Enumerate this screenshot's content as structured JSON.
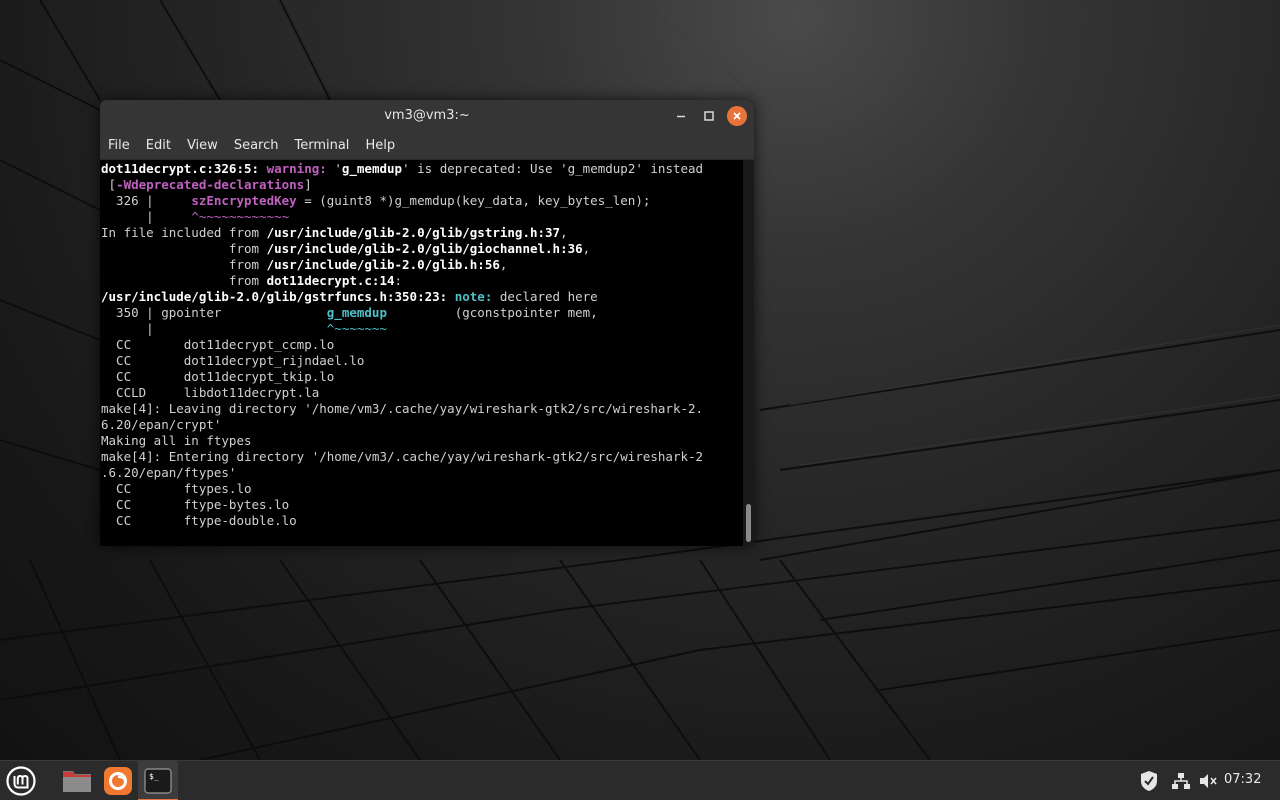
{
  "window": {
    "title": "vm3@vm3:~",
    "minimize_icon": "minimize-icon",
    "maximize_icon": "maximize-icon",
    "close_icon": "close-icon"
  },
  "menubar": {
    "items": [
      "File",
      "Edit",
      "View",
      "Search",
      "Terminal",
      "Help"
    ]
  },
  "terminal": {
    "lines": [
      [
        {
          "t": "dot11decrypt.c:326:5: ",
          "c": "b"
        },
        {
          "t": "warning: ",
          "c": "warn"
        },
        {
          "t": "'",
          "c": ""
        },
        {
          "t": "g_memdup",
          "c": "b"
        },
        {
          "t": "' is deprecated: Use 'g_memdup2' instead",
          "c": ""
        }
      ],
      [
        {
          "t": " [",
          "c": ""
        },
        {
          "t": "-Wdeprecated-declarations",
          "c": "wflag"
        },
        {
          "t": "]",
          "c": ""
        }
      ],
      [
        {
          "t": "  326 |     ",
          "c": ""
        },
        {
          "t": "szEncryptedKey",
          "c": "warn"
        },
        {
          "t": " = (guint8 *)g_memdup(key_data, key_bytes_len);",
          "c": ""
        }
      ],
      [
        {
          "t": "      |     ",
          "c": ""
        },
        {
          "t": "^~~~~~~~~~~~~",
          "c": "tilde-m"
        }
      ],
      [
        {
          "t": "In file included from ",
          "c": ""
        },
        {
          "t": "/usr/include/glib-2.0/glib/gstring.h:37",
          "c": "b"
        },
        {
          "t": ",",
          "c": ""
        }
      ],
      [
        {
          "t": "                 from ",
          "c": ""
        },
        {
          "t": "/usr/include/glib-2.0/glib/giochannel.h:36",
          "c": "b"
        },
        {
          "t": ",",
          "c": ""
        }
      ],
      [
        {
          "t": "                 from ",
          "c": ""
        },
        {
          "t": "/usr/include/glib-2.0/glib.h:56",
          "c": "b"
        },
        {
          "t": ",",
          "c": ""
        }
      ],
      [
        {
          "t": "                 from ",
          "c": ""
        },
        {
          "t": "dot11decrypt.c:14",
          "c": "b"
        },
        {
          "t": ":",
          "c": ""
        }
      ],
      [
        {
          "t": "/usr/include/glib-2.0/glib/gstrfuncs.h:350:23: ",
          "c": "b"
        },
        {
          "t": "note: ",
          "c": "note"
        },
        {
          "t": "declared here",
          "c": ""
        }
      ],
      [
        {
          "t": "  350 | gpointer              ",
          "c": ""
        },
        {
          "t": "g_memdup",
          "c": "cyan"
        },
        {
          "t": "         (gconstpointer mem,",
          "c": ""
        }
      ],
      [
        {
          "t": "      |                       ",
          "c": ""
        },
        {
          "t": "^~~~~~~~",
          "c": "tilde-c"
        }
      ],
      [
        {
          "t": "  CC       dot11decrypt_ccmp.lo",
          "c": ""
        }
      ],
      [
        {
          "t": "  CC       dot11decrypt_rijndael.lo",
          "c": ""
        }
      ],
      [
        {
          "t": "  CC       dot11decrypt_tkip.lo",
          "c": ""
        }
      ],
      [
        {
          "t": "  CCLD     libdot11decrypt.la",
          "c": ""
        }
      ],
      [
        {
          "t": "make[4]: Leaving directory '/home/vm3/.cache/yay/wireshark-gtk2/src/wireshark-2.",
          "c": ""
        }
      ],
      [
        {
          "t": "6.20/epan/crypt'",
          "c": ""
        }
      ],
      [
        {
          "t": "Making all in ftypes",
          "c": ""
        }
      ],
      [
        {
          "t": "make[4]: Entering directory '/home/vm3/.cache/yay/wireshark-gtk2/src/wireshark-2",
          "c": ""
        }
      ],
      [
        {
          "t": ".6.20/epan/ftypes'",
          "c": ""
        }
      ],
      [
        {
          "t": "  CC       ftypes.lo",
          "c": ""
        }
      ],
      [
        {
          "t": "  CC       ftype-bytes.lo",
          "c": ""
        }
      ],
      [
        {
          "t": "  CC       ftype-double.lo",
          "c": ""
        }
      ]
    ]
  },
  "taskbar": {
    "menu_icon": "linux-mint-logo-icon",
    "launchers": [
      "files-folder-icon",
      "firefox-icon",
      "terminal-icon"
    ],
    "tray": [
      "shield-icon",
      "network-icon",
      "volume-muted-icon"
    ],
    "clock": "07:32"
  },
  "colors": {
    "accent": "#e8743c",
    "titlebar": "#353535",
    "warning": "#c060c0",
    "note": "#4fc0c8"
  }
}
